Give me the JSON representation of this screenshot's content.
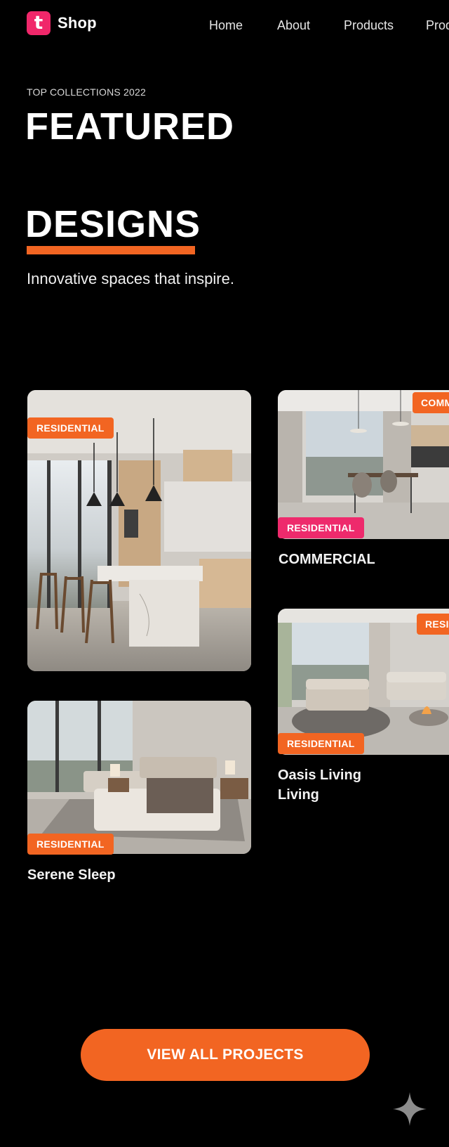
{
  "brand": {
    "logo_letter": "t",
    "name": "Shop",
    "accent": "#f0276a"
  },
  "nav": {
    "items": [
      "Home",
      "About",
      "Products",
      "Prod"
    ]
  },
  "hero": {
    "eyebrow": "TOP COLLECTIONS 2022",
    "title_line1": "FEATURED",
    "title_line2": "DESIGNS",
    "tagline": "Innovative spaces that inspire."
  },
  "cards": [
    {
      "tag": "RESIDENTIAL",
      "title": "",
      "image": "kitchen"
    },
    {
      "tag": "RESIDENTIAL",
      "corner_tag": "COMM",
      "title": "COMMERCIAL",
      "image": "office"
    },
    {
      "tag": "RESIDENTIAL",
      "corner_tag": "RESIL",
      "title_line1": "Oasis Living",
      "title_line2": "Living",
      "image": "living-room"
    },
    {
      "tag": "RESIDENTIAL",
      "title": "Serene Sleep",
      "image": "bedroom"
    }
  ],
  "cta": {
    "label": "VIEW ALL PROJECTS"
  },
  "colors": {
    "orange": "#f26522",
    "pink": "#ee2a6c",
    "background": "#000000"
  },
  "icons": {
    "assistant": "sparkle-icon"
  }
}
